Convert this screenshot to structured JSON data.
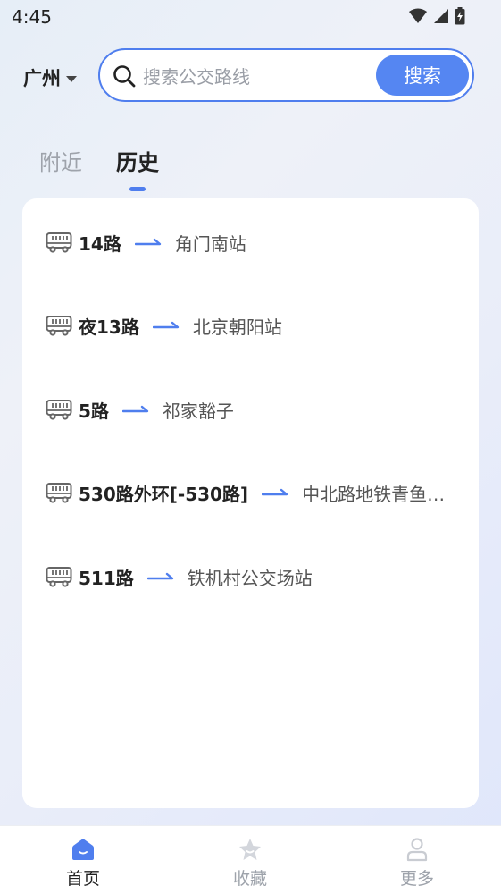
{
  "status": {
    "time": "4:45"
  },
  "header": {
    "city": "广州",
    "search_placeholder": "搜索公交路线",
    "search_button": "搜索"
  },
  "tabs": [
    {
      "label": "附近",
      "active": false
    },
    {
      "label": "历史",
      "active": true
    }
  ],
  "routes": [
    {
      "name": "14路",
      "destination": "角门南站"
    },
    {
      "name": "夜13路",
      "destination": "北京朝阳站"
    },
    {
      "name": "5路",
      "destination": "祁家豁子"
    },
    {
      "name": "530路外环[-530路]",
      "destination": "中北路地铁青鱼…"
    },
    {
      "name": "511路",
      "destination": "铁机村公交场站"
    }
  ],
  "bottom_nav": [
    {
      "label": "首页",
      "active": true
    },
    {
      "label": "收藏",
      "active": false
    },
    {
      "label": "更多",
      "active": false
    }
  ],
  "colors": {
    "accent": "#4f7eee",
    "inactive": "#9ea3ab"
  }
}
